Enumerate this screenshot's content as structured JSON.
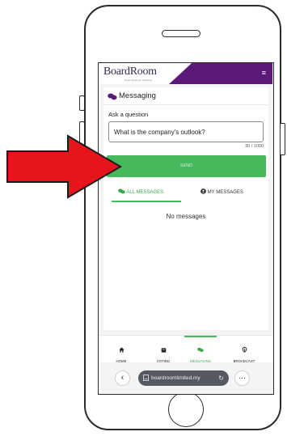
{
  "header": {
    "brand": "BoardRoom",
    "brand_sub": "Smart Business Solutions",
    "menu_icon": "hamburger-menu-icon",
    "brand_color": "#5b1a7a"
  },
  "card": {
    "title": "Messaging",
    "title_icon": "chat-bubbles-icon",
    "ask_label": "Ask a question",
    "question_value": "What is the company's outlook?",
    "counter": "30 / 1000",
    "send_label": "SEND",
    "send_color": "#48b85c"
  },
  "tabs": {
    "all_label": "ALL MESSAGES",
    "all_icon": "chat-bubbles-icon",
    "my_label": "MY MESSAGES",
    "my_icon": "user-circle-icon"
  },
  "messages": {
    "empty_text": "No messages"
  },
  "bottom_nav": {
    "items": [
      {
        "label": "HOME",
        "icon": "home-icon"
      },
      {
        "label": "VOTING",
        "icon": "ballot-box-icon"
      },
      {
        "label": "MESSAGING",
        "icon": "chat-bubbles-icon",
        "active": true
      },
      {
        "label": "BROADCAST",
        "icon": "broadcast-icon"
      }
    ]
  },
  "browser": {
    "url": "boardroomlimited.my",
    "back_icon": "chevron-left-icon",
    "reload_icon": "reload-icon",
    "more_icon": "ellipsis-icon"
  },
  "annotation": {
    "arrow_color": "#e8141b",
    "arrow_icon": "right-arrow-icon"
  }
}
